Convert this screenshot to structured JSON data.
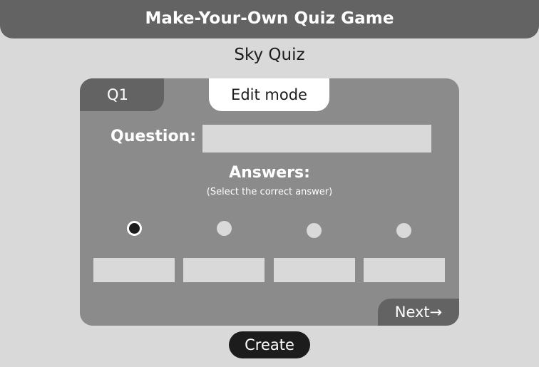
{
  "header": {
    "title": "Make-Your-Own Quiz Game"
  },
  "quiz": {
    "title": "Sky Quiz"
  },
  "card": {
    "question_tab": "Q1",
    "mode_tab": "Edit mode",
    "question_label": "Question:",
    "question_value": "",
    "answers_label": "Answers:",
    "answers_hint": "(Select the correct answer)",
    "selected_answer_index": 0,
    "answers": [
      "",
      "",
      "",
      ""
    ],
    "next_label": "Next→"
  },
  "footer": {
    "create_label": "Create"
  },
  "colors": {
    "background": "#d9d9d9",
    "header": "#636363",
    "card": "#8b8b8b",
    "tab_dark": "#636363",
    "tab_light": "#ffffff",
    "input": "#d9d9d9",
    "button_dark": "#1c1c1c"
  }
}
